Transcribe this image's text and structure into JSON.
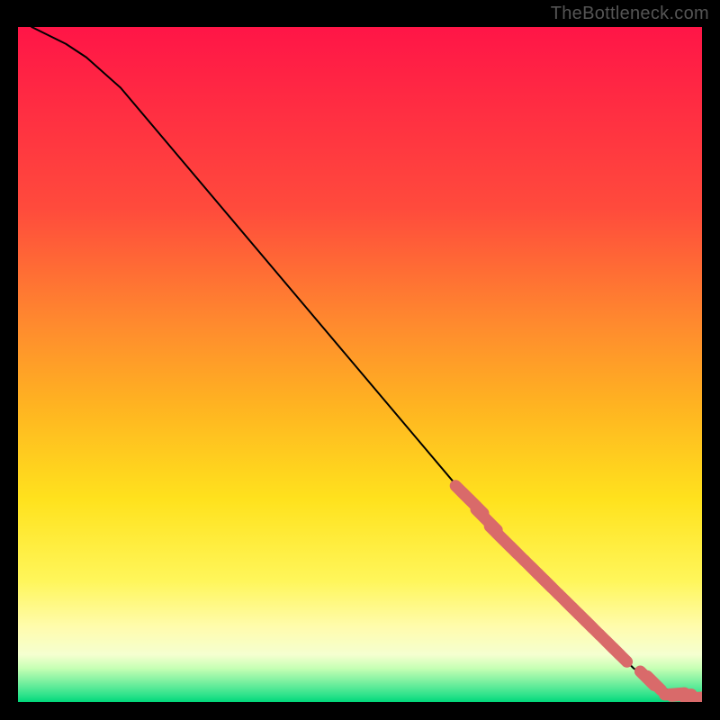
{
  "watermark": "TheBottleneck.com",
  "colors": {
    "background": "#000000",
    "line": "#000000",
    "marker_fill": "#d96a6a",
    "gradient_stops": [
      {
        "pct": 0,
        "color": "#ff1547"
      },
      {
        "pct": 27,
        "color": "#ff4b3c"
      },
      {
        "pct": 44,
        "color": "#ff8a2e"
      },
      {
        "pct": 56,
        "color": "#ffb321"
      },
      {
        "pct": 70,
        "color": "#ffe21d"
      },
      {
        "pct": 82,
        "color": "#fff65a"
      },
      {
        "pct": 89,
        "color": "#fffcae"
      },
      {
        "pct": 93,
        "color": "#f5ffd0"
      },
      {
        "pct": 95,
        "color": "#c6ffb4"
      },
      {
        "pct": 97,
        "color": "#7bf0a0"
      },
      {
        "pct": 99,
        "color": "#2de28b"
      },
      {
        "pct": 100,
        "color": "#00d77a"
      }
    ]
  },
  "chart_data": {
    "type": "line",
    "title": "",
    "xlabel": "",
    "ylabel": "",
    "xlim": [
      0,
      100
    ],
    "ylim": [
      0,
      100
    ],
    "series": [
      {
        "name": "curve",
        "x": [
          2,
          4,
          7,
          10,
          15,
          20,
          25,
          30,
          35,
          40,
          45,
          50,
          55,
          60,
          65,
          70,
          72,
          75,
          78,
          80,
          82,
          84,
          86,
          88,
          90,
          92,
          93,
          95,
          97,
          98,
          100
        ],
        "y": [
          100,
          99,
          97.5,
          95.5,
          91,
          85,
          79,
          73,
          67,
          61,
          55,
          49,
          43,
          37,
          31,
          25,
          23,
          20,
          17,
          15,
          13,
          11,
          9,
          7,
          5,
          3.5,
          2.8,
          1.8,
          1.0,
          0.6,
          0.5
        ]
      }
    ],
    "markers": {
      "name": "highlighted-points",
      "x": [
        65,
        66,
        67,
        68,
        69,
        70,
        71,
        72,
        73,
        75,
        76,
        77,
        78,
        80,
        81,
        82,
        83,
        84,
        86,
        87,
        88,
        92,
        93,
        96,
        97,
        99,
        100
      ],
      "y": [
        31,
        30,
        29,
        27.5,
        26.5,
        25,
        24,
        23,
        22,
        20,
        19,
        18,
        17,
        15,
        14,
        13,
        12,
        11,
        9,
        8,
        7,
        3.5,
        2.8,
        1.2,
        1.0,
        0.6,
        0.5
      ]
    }
  }
}
